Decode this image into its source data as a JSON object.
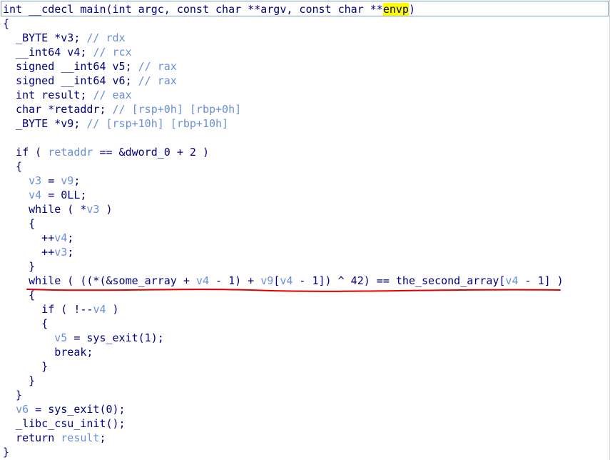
{
  "lines": [
    [
      {
        "t": "int __cdecl main(int argc, const char **argv, const char **",
        "c": "plain"
      },
      {
        "t": "envp",
        "c": "hl"
      },
      {
        "t": ")",
        "c": "plain"
      }
    ],
    [
      {
        "t": "{",
        "c": "plain"
      }
    ],
    [
      {
        "t": "  _BYTE *v3; ",
        "c": "plain"
      },
      {
        "t": "// rdx",
        "c": "cm"
      }
    ],
    [
      {
        "t": "  __int64 v4; ",
        "c": "plain"
      },
      {
        "t": "// rcx",
        "c": "cm"
      }
    ],
    [
      {
        "t": "  signed __int64 v5; ",
        "c": "plain"
      },
      {
        "t": "// rax",
        "c": "cm"
      }
    ],
    [
      {
        "t": "  signed __int64 v6; ",
        "c": "plain"
      },
      {
        "t": "// rax",
        "c": "cm"
      }
    ],
    [
      {
        "t": "  int result; ",
        "c": "plain"
      },
      {
        "t": "// eax",
        "c": "cm"
      }
    ],
    [
      {
        "t": "  char *retaddr; ",
        "c": "plain"
      },
      {
        "t": "// [rsp+0h] [rbp+0h]",
        "c": "cm"
      }
    ],
    [
      {
        "t": "  _BYTE *v9; ",
        "c": "plain"
      },
      {
        "t": "// [rsp+10h] [rbp+10h]",
        "c": "cm"
      }
    ],
    [
      {
        "t": "",
        "c": "plain"
      }
    ],
    [
      {
        "t": "  if ( ",
        "c": "plain"
      },
      {
        "t": "retaddr",
        "c": "var"
      },
      {
        "t": " == &dword_0 + 2 )",
        "c": "plain"
      }
    ],
    [
      {
        "t": "  {",
        "c": "plain"
      }
    ],
    [
      {
        "t": "    ",
        "c": "plain"
      },
      {
        "t": "v3",
        "c": "var"
      },
      {
        "t": " = ",
        "c": "plain"
      },
      {
        "t": "v9",
        "c": "var"
      },
      {
        "t": ";",
        "c": "plain"
      }
    ],
    [
      {
        "t": "    ",
        "c": "plain"
      },
      {
        "t": "v4",
        "c": "var"
      },
      {
        "t": " = 0LL;",
        "c": "plain"
      }
    ],
    [
      {
        "t": "    while ( *",
        "c": "plain"
      },
      {
        "t": "v3",
        "c": "var"
      },
      {
        "t": " )",
        "c": "plain"
      }
    ],
    [
      {
        "t": "    {",
        "c": "plain"
      }
    ],
    [
      {
        "t": "      ++",
        "c": "plain"
      },
      {
        "t": "v4",
        "c": "var"
      },
      {
        "t": ";",
        "c": "plain"
      }
    ],
    [
      {
        "t": "      ++",
        "c": "plain"
      },
      {
        "t": "v3",
        "c": "var"
      },
      {
        "t": ";",
        "c": "plain"
      }
    ],
    [
      {
        "t": "    }",
        "c": "plain"
      }
    ],
    [
      {
        "t": "    while ( ((*(&some_array + ",
        "c": "plain"
      },
      {
        "t": "v4",
        "c": "var"
      },
      {
        "t": " - 1) + ",
        "c": "plain"
      },
      {
        "t": "v9",
        "c": "var"
      },
      {
        "t": "[",
        "c": "plain"
      },
      {
        "t": "v4",
        "c": "var"
      },
      {
        "t": " - 1]) ^ 42) == the_second_array[",
        "c": "plain"
      },
      {
        "t": "v4",
        "c": "var"
      },
      {
        "t": " - 1] )",
        "c": "plain"
      }
    ],
    [
      {
        "t": "    {",
        "c": "plain"
      }
    ],
    [
      {
        "t": "      if ( !--",
        "c": "plain"
      },
      {
        "t": "v4",
        "c": "var"
      },
      {
        "t": " )",
        "c": "plain"
      }
    ],
    [
      {
        "t": "      {",
        "c": "plain"
      }
    ],
    [
      {
        "t": "        ",
        "c": "plain"
      },
      {
        "t": "v5",
        "c": "var"
      },
      {
        "t": " = sys_exit(1);",
        "c": "plain"
      }
    ],
    [
      {
        "t": "        break;",
        "c": "plain"
      }
    ],
    [
      {
        "t": "      }",
        "c": "plain"
      }
    ],
    [
      {
        "t": "    }",
        "c": "plain"
      }
    ],
    [
      {
        "t": "  }",
        "c": "plain"
      }
    ],
    [
      {
        "t": "  ",
        "c": "plain"
      },
      {
        "t": "v6",
        "c": "var"
      },
      {
        "t": " = sys_exit(0);",
        "c": "plain"
      }
    ],
    [
      {
        "t": "  _libc_csu_init();",
        "c": "plain"
      }
    ],
    [
      {
        "t": "  return ",
        "c": "plain"
      },
      {
        "t": "result",
        "c": "var"
      },
      {
        "t": ";",
        "c": "plain"
      }
    ],
    [
      {
        "t": "}",
        "c": "plain"
      }
    ]
  ],
  "colors": {
    "code_text": "#000080",
    "variable": "#6a8fd8",
    "comment": "#6a8fd8",
    "highlight_bg": "#ffff00",
    "annotation_underline": "#e00000"
  }
}
